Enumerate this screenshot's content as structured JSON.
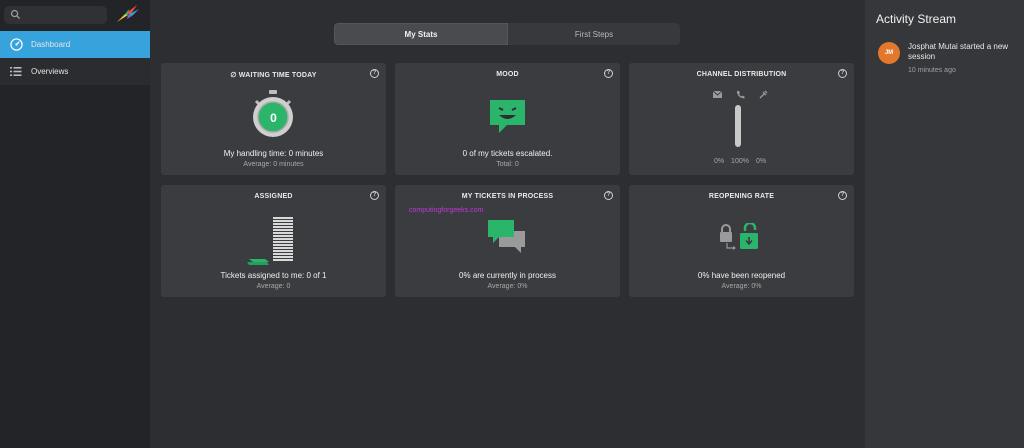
{
  "sidebar": {
    "search_placeholder": "",
    "items": [
      {
        "label": "Dashboard",
        "icon": "dashboard-icon",
        "active": true
      },
      {
        "label": "Overviews",
        "icon": "list-icon",
        "active": false
      }
    ]
  },
  "tabs": [
    {
      "label": "My Stats",
      "active": true
    },
    {
      "label": "First Steps",
      "active": false
    }
  ],
  "cards": {
    "waiting_time": {
      "title": "∅ WAITING TIME TODAY",
      "value": "0",
      "main": "My handling time: 0 minutes",
      "sub": "Average: 0 minutes"
    },
    "mood": {
      "title": "MOOD",
      "main": "0 of my tickets escalated.",
      "sub": "Total: 0"
    },
    "channel": {
      "title": "CHANNEL DISTRIBUTION",
      "channels": [
        {
          "icon": "email-icon",
          "percent": "0%"
        },
        {
          "icon": "phone-icon",
          "percent": "100%"
        },
        {
          "icon": "web-icon",
          "percent": "0%"
        }
      ]
    },
    "assigned": {
      "title": "ASSIGNED",
      "main": "Tickets assigned to me: 0 of 1",
      "sub": "Average: 0"
    },
    "in_process": {
      "title": "MY TICKETS IN PROCESS",
      "main": "0% are currently in process",
      "sub": "Average: 0%"
    },
    "reopening": {
      "title": "REOPENING RATE",
      "main": "0% have been reopened",
      "sub": "Average: 0%"
    },
    "help_symbol": "?"
  },
  "watermark": "computingforgeeks.com",
  "activity": {
    "title": "Activity Stream",
    "items": [
      {
        "initials": "JM",
        "text": "Josphat Mutai started a new session",
        "time": "10 minutes ago"
      }
    ]
  },
  "colors": {
    "accent": "#37a3dd",
    "success": "#2bb56a",
    "avatar": "#e2782b"
  }
}
